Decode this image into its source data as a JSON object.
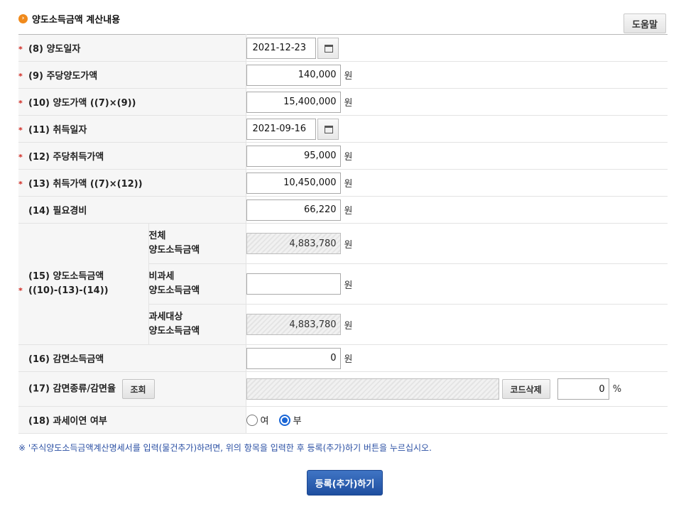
{
  "section": {
    "title": "양도소득금액 계산내용",
    "help_label": "도움말"
  },
  "colors": {
    "required": "#d0271f",
    "accent": "#1f4fa0",
    "note": "#2a4fa3"
  },
  "rows": {
    "r8": {
      "label": "(8) 양도일자",
      "value": "2021-12-23"
    },
    "r9": {
      "label": "(9) 주당양도가액",
      "value": "140,000",
      "unit": "원"
    },
    "r10": {
      "label": "(10) 양도가액 ((7)×(9))",
      "value": "15,400,000",
      "unit": "원"
    },
    "r11": {
      "label": "(11) 취득일자",
      "value": "2021-09-16"
    },
    "r12": {
      "label": "(12) 주당취득가액",
      "value": "95,000",
      "unit": "원"
    },
    "r13": {
      "label": "(13) 취득가액 ((7)×(12))",
      "value": "10,450,000",
      "unit": "원"
    },
    "r14": {
      "label": "(14) 필요경비",
      "value": "66,220",
      "unit": "원"
    },
    "r15": {
      "label_line1": "(15) 양도소득금액",
      "label_line2": "((10)-(13)-(14))",
      "total": {
        "label_line1": "전체",
        "label_line2": "양도소득금액",
        "value": "4,883,780",
        "unit": "원"
      },
      "nontax": {
        "label_line1": "비과세",
        "label_line2": "양도소득금액",
        "value": "",
        "unit": "원"
      },
      "taxable": {
        "label_line1": "과세대상",
        "label_line2": "양도소득금액",
        "value": "4,883,780",
        "unit": "원"
      }
    },
    "r16": {
      "label": "(16) 감면소득금액",
      "value": "0",
      "unit": "원"
    },
    "r17": {
      "label": "(17) 감면종류/감면율",
      "lookup_label": "조회",
      "code_value": "",
      "delete_label": "코드삭제",
      "rate_value": "0",
      "unit": "%"
    },
    "r18": {
      "label": "(18) 과세이연 여부",
      "yes_label": "여",
      "no_label": "부",
      "selected": "부"
    }
  },
  "required_mark": "*",
  "note": "※ '주식양도소득금액계산명세서를 입력(물건추가)하려면, 위의 항목을 입력한 후 등록(추가)하기 버튼을 누르십시오.",
  "submit_label": "등록(추가)하기"
}
